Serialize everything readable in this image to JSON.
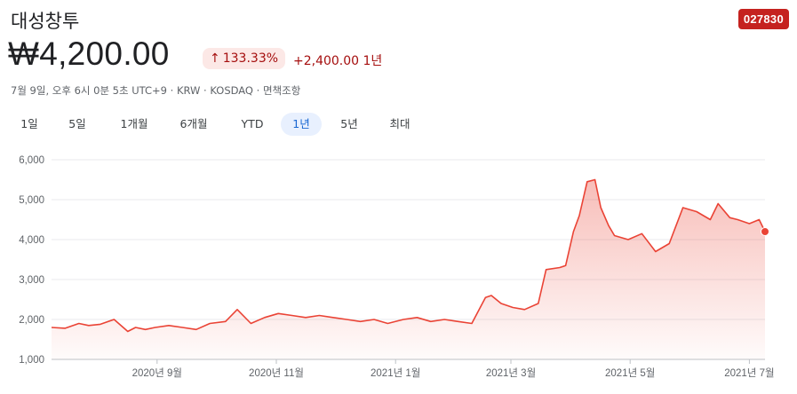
{
  "header": {
    "company_name": "대성창투",
    "ticker": "027830",
    "price": "₩4,200.00",
    "percent_change": "133.33%",
    "abs_change": "+2,400.00 1년",
    "meta": "7월 9일, 오후 6시 0분 5초 UTC+9 · KRW · KOSDAQ · 면책조항"
  },
  "icons": {
    "change_direction": "arrow-up-icon"
  },
  "colors": {
    "up_red": "#a50e0e",
    "line": "#ea4335",
    "badge_bg": "#fce8e6",
    "ticker_bg": "#c5221f",
    "active_range": "#1967d2"
  },
  "ranges": [
    "1일",
    "5일",
    "1개월",
    "6개월",
    "YTD",
    "1년",
    "5년",
    "최대"
  ],
  "active_range": "1년",
  "chart_data": {
    "type": "area",
    "title": "",
    "xlabel": "",
    "ylabel": "",
    "ylim": [
      1000,
      6000
    ],
    "yticks": [
      1000,
      2000,
      3000,
      4000,
      5000,
      6000
    ],
    "ytick_labels": [
      "1,000",
      "2,000",
      "3,000",
      "4,000",
      "5,000",
      "6,000"
    ],
    "xlim": [
      "2020-07-09",
      "2021-07-09"
    ],
    "xticks": [
      {
        "date": "2020-09-01",
        "label": "2020년 9월"
      },
      {
        "date": "2020-11-01",
        "label": "2020년 11월"
      },
      {
        "date": "2021-01-01",
        "label": "2021년 1월"
      },
      {
        "date": "2021-03-01",
        "label": "2021년 3월"
      },
      {
        "date": "2021-05-01",
        "label": "2021년 5월"
      },
      {
        "date": "2021-07-01",
        "label": "2021년 7월"
      }
    ],
    "grid": "horizontal",
    "series": [
      {
        "x": [
          "2020-07-09",
          "2020-07-16",
          "2020-07-23",
          "2020-07-28",
          "2020-08-03",
          "2020-08-10",
          "2020-08-17",
          "2020-08-21",
          "2020-08-26",
          "2020-08-31",
          "2020-09-07",
          "2020-09-14",
          "2020-09-21",
          "2020-09-28",
          "2020-10-06",
          "2020-10-12",
          "2020-10-19",
          "2020-10-26",
          "2020-11-02",
          "2020-11-09",
          "2020-11-16",
          "2020-11-23",
          "2020-11-30",
          "2020-12-07",
          "2020-12-14",
          "2020-12-21",
          "2020-12-28",
          "2021-01-05",
          "2021-01-12",
          "2021-01-19",
          "2021-01-26",
          "2021-02-02",
          "2021-02-09",
          "2021-02-16",
          "2021-02-19",
          "2021-02-24",
          "2021-03-02",
          "2021-03-08",
          "2021-03-15",
          "2021-03-19",
          "2021-03-26",
          "2021-03-29",
          "2021-04-02",
          "2021-04-05",
          "2021-04-09",
          "2021-04-13",
          "2021-04-16",
          "2021-04-20",
          "2021-04-23",
          "2021-04-30",
          "2021-05-07",
          "2021-05-14",
          "2021-05-21",
          "2021-05-28",
          "2021-06-04",
          "2021-06-11",
          "2021-06-15",
          "2021-06-21",
          "2021-06-25",
          "2021-07-01",
          "2021-07-06",
          "2021-07-09"
        ],
        "y": [
          1800,
          1780,
          1900,
          1850,
          1880,
          2000,
          1700,
          1800,
          1750,
          1800,
          1850,
          1800,
          1750,
          1900,
          1950,
          2250,
          1900,
          2050,
          2150,
          2100,
          2050,
          2100,
          2050,
          2000,
          1950,
          2000,
          1900,
          2000,
          2050,
          1950,
          2000,
          1950,
          1900,
          2550,
          2600,
          2400,
          2300,
          2250,
          2400,
          3250,
          3300,
          3350,
          4200,
          4600,
          5450,
          5500,
          4800,
          4350,
          4100,
          4000,
          4150,
          3700,
          3900,
          4800,
          4700,
          4500,
          4900,
          4550,
          4500,
          4400,
          4500,
          4200
        ]
      }
    ]
  }
}
